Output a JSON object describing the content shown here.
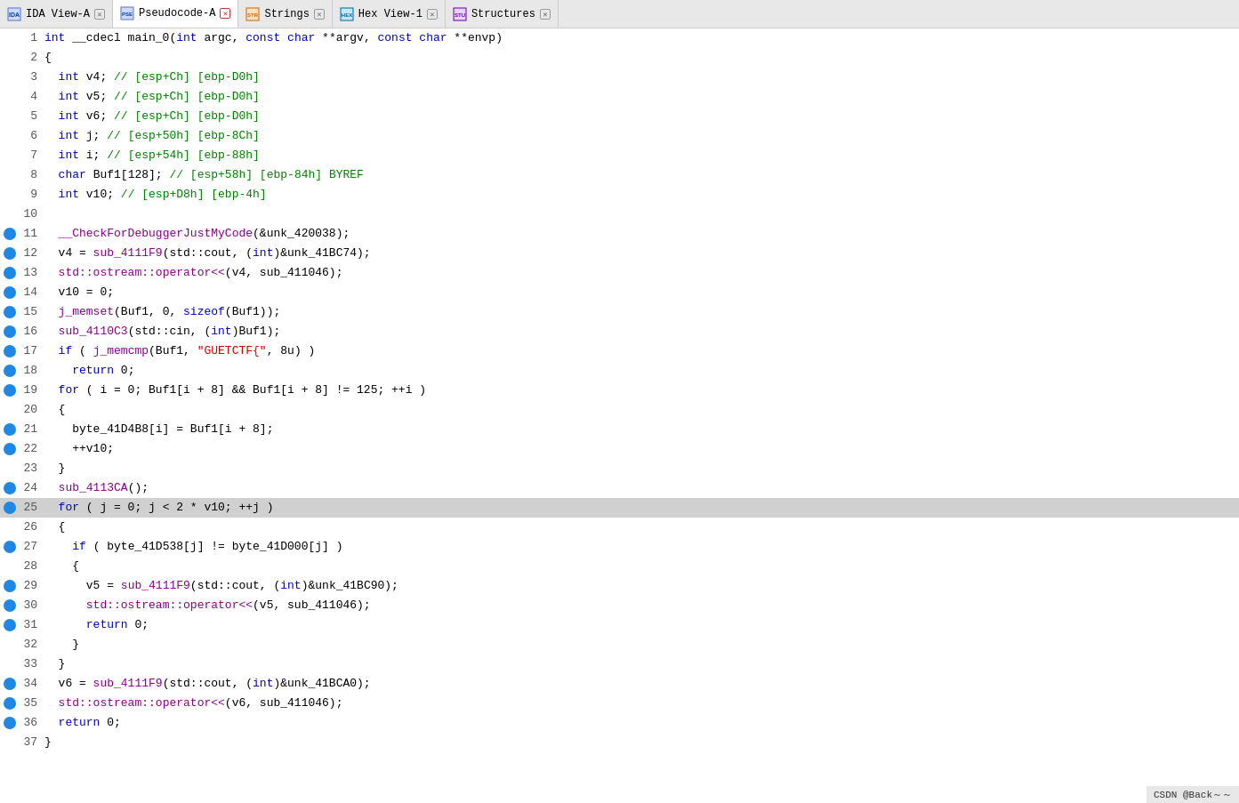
{
  "tabs": [
    {
      "id": "ida-view",
      "icon": "IDA",
      "label": "IDA View-A",
      "closable": true,
      "active": false
    },
    {
      "id": "pseudocode",
      "icon": "PSE",
      "label": "Pseudocode-A",
      "closable": true,
      "active": true
    },
    {
      "id": "strings",
      "icon": "STR",
      "label": "Strings",
      "closable": true,
      "active": false
    },
    {
      "id": "hex-view",
      "icon": "HEX",
      "label": "Hex View-1",
      "closable": true,
      "active": false
    },
    {
      "id": "structures",
      "icon": "STU",
      "label": "Structures",
      "closable": true,
      "active": false
    }
  ],
  "code": {
    "lines": [
      {
        "num": 1,
        "bp": false,
        "highlight": false,
        "tokens": [
          {
            "t": "kw",
            "v": "int"
          },
          {
            "t": "plain",
            "v": " __cdecl main_0("
          },
          {
            "t": "kw",
            "v": "int"
          },
          {
            "t": "plain",
            "v": " argc, "
          },
          {
            "t": "kw",
            "v": "const"
          },
          {
            "t": "plain",
            "v": " "
          },
          {
            "t": "kw",
            "v": "char"
          },
          {
            "t": "plain",
            "v": " **argv, "
          },
          {
            "t": "kw",
            "v": "const"
          },
          {
            "t": "plain",
            "v": " "
          },
          {
            "t": "kw",
            "v": "char"
          },
          {
            "t": "plain",
            "v": " **envp)"
          }
        ]
      },
      {
        "num": 2,
        "bp": false,
        "highlight": false,
        "tokens": [
          {
            "t": "plain",
            "v": "{"
          }
        ]
      },
      {
        "num": 3,
        "bp": false,
        "highlight": false,
        "tokens": [
          {
            "t": "plain",
            "v": "  "
          },
          {
            "t": "kw",
            "v": "int"
          },
          {
            "t": "plain",
            "v": " v4; "
          },
          {
            "t": "comment",
            "v": "// [esp+Ch] [ebp-D0h]"
          }
        ]
      },
      {
        "num": 4,
        "bp": false,
        "highlight": false,
        "tokens": [
          {
            "t": "plain",
            "v": "  "
          },
          {
            "t": "kw",
            "v": "int"
          },
          {
            "t": "plain",
            "v": " v5; "
          },
          {
            "t": "comment",
            "v": "// [esp+Ch] [ebp-D0h]"
          }
        ]
      },
      {
        "num": 5,
        "bp": false,
        "highlight": false,
        "tokens": [
          {
            "t": "plain",
            "v": "  "
          },
          {
            "t": "kw",
            "v": "int"
          },
          {
            "t": "plain",
            "v": " v6; "
          },
          {
            "t": "comment",
            "v": "// [esp+Ch] [ebp-D0h]"
          }
        ]
      },
      {
        "num": 6,
        "bp": false,
        "highlight": false,
        "tokens": [
          {
            "t": "plain",
            "v": "  "
          },
          {
            "t": "kw",
            "v": "int"
          },
          {
            "t": "plain",
            "v": " j; "
          },
          {
            "t": "comment",
            "v": "// [esp+50h] [ebp-8Ch]"
          }
        ]
      },
      {
        "num": 7,
        "bp": false,
        "highlight": false,
        "tokens": [
          {
            "t": "plain",
            "v": "  "
          },
          {
            "t": "kw",
            "v": "int"
          },
          {
            "t": "plain",
            "v": " i; "
          },
          {
            "t": "comment",
            "v": "// [esp+54h] [ebp-88h]"
          }
        ]
      },
      {
        "num": 8,
        "bp": false,
        "highlight": false,
        "tokens": [
          {
            "t": "plain",
            "v": "  "
          },
          {
            "t": "kw",
            "v": "char"
          },
          {
            "t": "plain",
            "v": " Buf1[128]; "
          },
          {
            "t": "comment",
            "v": "// [esp+58h] [ebp-84h] BYREF"
          }
        ]
      },
      {
        "num": 9,
        "bp": false,
        "highlight": false,
        "tokens": [
          {
            "t": "plain",
            "v": "  "
          },
          {
            "t": "kw",
            "v": "int"
          },
          {
            "t": "plain",
            "v": " v10; "
          },
          {
            "t": "comment",
            "v": "// [esp+D8h] [ebp-4h]"
          }
        ]
      },
      {
        "num": 10,
        "bp": false,
        "highlight": false,
        "tokens": [
          {
            "t": "plain",
            "v": ""
          }
        ]
      },
      {
        "num": 11,
        "bp": true,
        "highlight": false,
        "tokens": [
          {
            "t": "plain",
            "v": "  "
          },
          {
            "t": "func",
            "v": "__CheckForDebuggerJustMyCode"
          },
          {
            "t": "plain",
            "v": "(&unk_420038);"
          }
        ]
      },
      {
        "num": 12,
        "bp": true,
        "highlight": false,
        "tokens": [
          {
            "t": "plain",
            "v": "  v4 = "
          },
          {
            "t": "func",
            "v": "sub_4111F9"
          },
          {
            "t": "plain",
            "v": "(std::cout, ("
          },
          {
            "t": "kw",
            "v": "int"
          },
          {
            "t": "plain",
            "v": ")&unk_41BC74);"
          }
        ]
      },
      {
        "num": 13,
        "bp": true,
        "highlight": false,
        "tokens": [
          {
            "t": "plain",
            "v": "  "
          },
          {
            "t": "func",
            "v": "std::ostream::operator<<"
          },
          {
            "t": "plain",
            "v": "(v4, sub_411046);"
          }
        ]
      },
      {
        "num": 14,
        "bp": true,
        "highlight": false,
        "tokens": [
          {
            "t": "plain",
            "v": "  v10 = 0;"
          }
        ]
      },
      {
        "num": 15,
        "bp": true,
        "highlight": false,
        "tokens": [
          {
            "t": "plain",
            "v": "  "
          },
          {
            "t": "func",
            "v": "j_memset"
          },
          {
            "t": "plain",
            "v": "(Buf1, 0, "
          },
          {
            "t": "kw",
            "v": "sizeof"
          },
          {
            "t": "plain",
            "v": "(Buf1));"
          }
        ]
      },
      {
        "num": 16,
        "bp": true,
        "highlight": false,
        "tokens": [
          {
            "t": "plain",
            "v": "  "
          },
          {
            "t": "func",
            "v": "sub_4110C3"
          },
          {
            "t": "plain",
            "v": "(std::cin, ("
          },
          {
            "t": "kw",
            "v": "int"
          },
          {
            "t": "plain",
            "v": ")Buf1);"
          }
        ]
      },
      {
        "num": 17,
        "bp": true,
        "highlight": false,
        "tokens": [
          {
            "t": "plain",
            "v": "  "
          },
          {
            "t": "kw",
            "v": "if"
          },
          {
            "t": "plain",
            "v": " ( "
          },
          {
            "t": "func",
            "v": "j_memcmp"
          },
          {
            "t": "plain",
            "v": "(Buf1, "
          },
          {
            "t": "string",
            "v": "\"GUETCTF{\""
          },
          {
            "t": "plain",
            "v": ", 8u) )"
          }
        ]
      },
      {
        "num": 18,
        "bp": true,
        "highlight": false,
        "tokens": [
          {
            "t": "plain",
            "v": "    "
          },
          {
            "t": "kw",
            "v": "return"
          },
          {
            "t": "plain",
            "v": " 0;"
          }
        ]
      },
      {
        "num": 19,
        "bp": true,
        "highlight": false,
        "tokens": [
          {
            "t": "plain",
            "v": "  "
          },
          {
            "t": "kw",
            "v": "for"
          },
          {
            "t": "plain",
            "v": " ( i = 0; Buf1[i + 8] && Buf1[i + 8] != 125; ++i )"
          }
        ]
      },
      {
        "num": 20,
        "bp": false,
        "highlight": false,
        "tokens": [
          {
            "t": "plain",
            "v": "  {"
          }
        ]
      },
      {
        "num": 21,
        "bp": true,
        "highlight": false,
        "tokens": [
          {
            "t": "plain",
            "v": "    byte_41D4B8[i] = Buf1[i + 8];"
          }
        ]
      },
      {
        "num": 22,
        "bp": true,
        "highlight": false,
        "tokens": [
          {
            "t": "plain",
            "v": "    ++v10;"
          }
        ]
      },
      {
        "num": 23,
        "bp": false,
        "highlight": false,
        "tokens": [
          {
            "t": "plain",
            "v": "  }"
          }
        ]
      },
      {
        "num": 24,
        "bp": true,
        "highlight": false,
        "tokens": [
          {
            "t": "plain",
            "v": "  "
          },
          {
            "t": "func",
            "v": "sub_4113CA"
          },
          {
            "t": "plain",
            "v": "();"
          }
        ]
      },
      {
        "num": 25,
        "bp": true,
        "highlight": true,
        "tokens": [
          {
            "t": "plain",
            "v": "  "
          },
          {
            "t": "kw",
            "v": "for"
          },
          {
            "t": "plain",
            "v": " ( j = 0; j < 2 * v10; ++j )"
          }
        ]
      },
      {
        "num": 26,
        "bp": false,
        "highlight": false,
        "tokens": [
          {
            "t": "plain",
            "v": "  {"
          }
        ]
      },
      {
        "num": 27,
        "bp": true,
        "highlight": false,
        "tokens": [
          {
            "t": "plain",
            "v": "    "
          },
          {
            "t": "kw",
            "v": "if"
          },
          {
            "t": "plain",
            "v": " ( byte_41D538[j] != byte_41D000[j] )"
          }
        ]
      },
      {
        "num": 28,
        "bp": false,
        "highlight": false,
        "tokens": [
          {
            "t": "plain",
            "v": "    {"
          }
        ]
      },
      {
        "num": 29,
        "bp": true,
        "highlight": false,
        "tokens": [
          {
            "t": "plain",
            "v": "      v5 = "
          },
          {
            "t": "func",
            "v": "sub_4111F9"
          },
          {
            "t": "plain",
            "v": "(std::cout, ("
          },
          {
            "t": "kw",
            "v": "int"
          },
          {
            "t": "plain",
            "v": ")&unk_41BC90);"
          }
        ]
      },
      {
        "num": 30,
        "bp": true,
        "highlight": false,
        "tokens": [
          {
            "t": "plain",
            "v": "      "
          },
          {
            "t": "func",
            "v": "std::ostream::operator<<"
          },
          {
            "t": "plain",
            "v": "(v5, sub_411046);"
          }
        ]
      },
      {
        "num": 31,
        "bp": true,
        "highlight": false,
        "tokens": [
          {
            "t": "plain",
            "v": "      "
          },
          {
            "t": "kw",
            "v": "return"
          },
          {
            "t": "plain",
            "v": " 0;"
          }
        ]
      },
      {
        "num": 32,
        "bp": false,
        "highlight": false,
        "tokens": [
          {
            "t": "plain",
            "v": "    }"
          }
        ]
      },
      {
        "num": 33,
        "bp": false,
        "highlight": false,
        "tokens": [
          {
            "t": "plain",
            "v": "  }"
          }
        ]
      },
      {
        "num": 34,
        "bp": true,
        "highlight": false,
        "tokens": [
          {
            "t": "plain",
            "v": "  v6 = "
          },
          {
            "t": "func",
            "v": "sub_4111F9"
          },
          {
            "t": "plain",
            "v": "(std::cout, ("
          },
          {
            "t": "kw",
            "v": "int"
          },
          {
            "t": "plain",
            "v": ")&unk_41BCA0);"
          }
        ]
      },
      {
        "num": 35,
        "bp": true,
        "highlight": false,
        "tokens": [
          {
            "t": "plain",
            "v": "  "
          },
          {
            "t": "func",
            "v": "std::ostream::operator<<"
          },
          {
            "t": "plain",
            "v": "(v6, sub_411046);"
          }
        ]
      },
      {
        "num": 36,
        "bp": true,
        "highlight": false,
        "tokens": [
          {
            "t": "plain",
            "v": "  "
          },
          {
            "t": "kw",
            "v": "return"
          },
          {
            "t": "plain",
            "v": " 0;"
          }
        ]
      },
      {
        "num": 37,
        "bp": false,
        "highlight": false,
        "tokens": [
          {
            "t": "plain",
            "v": "}"
          }
        ]
      }
    ]
  },
  "bottom_bar": {
    "text": "CSDN @Back～～"
  }
}
